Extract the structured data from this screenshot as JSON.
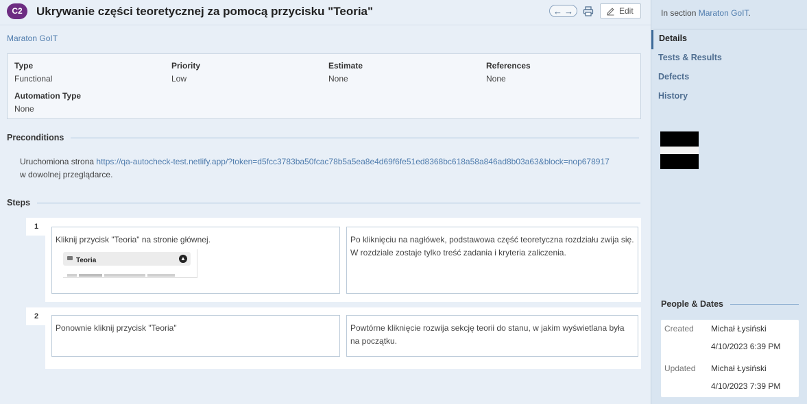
{
  "header": {
    "case_id": "C2",
    "title": "Ukrywanie części teoretycznej za pomocą przycisku \"Teoria\"",
    "edit_label": "Edit"
  },
  "section_link": "Maraton GoIT",
  "fields": {
    "type": {
      "label": "Type",
      "value": "Functional"
    },
    "priority": {
      "label": "Priority",
      "value": "Low"
    },
    "estimate": {
      "label": "Estimate",
      "value": "None"
    },
    "references": {
      "label": "References",
      "value": "None"
    },
    "automation": {
      "label": "Automation Type",
      "value": "None"
    }
  },
  "preconditions": {
    "heading": "Preconditions",
    "text_before": "Uruchomiona strona ",
    "url": "https://qa-autocheck-test.netlify.app/?token=d5fcc3783ba50fcac78b5a5ea8e4d69f6fe51ed8368bc618a58a846ad8b03a63&block=nop678917",
    "text_after": "w dowolnej przeglądarce."
  },
  "steps": {
    "heading": "Steps",
    "items": [
      {
        "number": "1",
        "action": "Kliknij przycisk \"Teoria\" na stronie głównej.",
        "image_label": "Teoria",
        "expected": "Po kliknięciu na nagłówek, podstawowa część teoretyczna rozdziału zwija się. W rozdziale zostaje tylko treść zadania i kryteria zaliczenia."
      },
      {
        "number": "2",
        "action": "Ponownie kliknij przycisk \"Teoria\"",
        "expected": "Powtórne kliknięcie rozwija sekcję teorii do stanu, w jakim wyświetlana była na początku."
      }
    ]
  },
  "sidebar": {
    "in_section_prefix": "In section",
    "in_section_link": "Maraton GoIT",
    "nav": [
      "Details",
      "Tests & Results",
      "Defects",
      "History"
    ],
    "people_heading": "People & Dates",
    "created_label": "Created",
    "created_by": "Michał Łysiński",
    "created_at": "4/10/2023 6:39 PM",
    "updated_label": "Updated",
    "updated_by": "Michał Łysiński",
    "updated_at": "4/10/2023 7:39 PM"
  },
  "colors": {
    "badge": "#6d2c82",
    "link": "#4f7cad",
    "background": "#e8eff7",
    "sidebar": "#d9e5f1"
  }
}
